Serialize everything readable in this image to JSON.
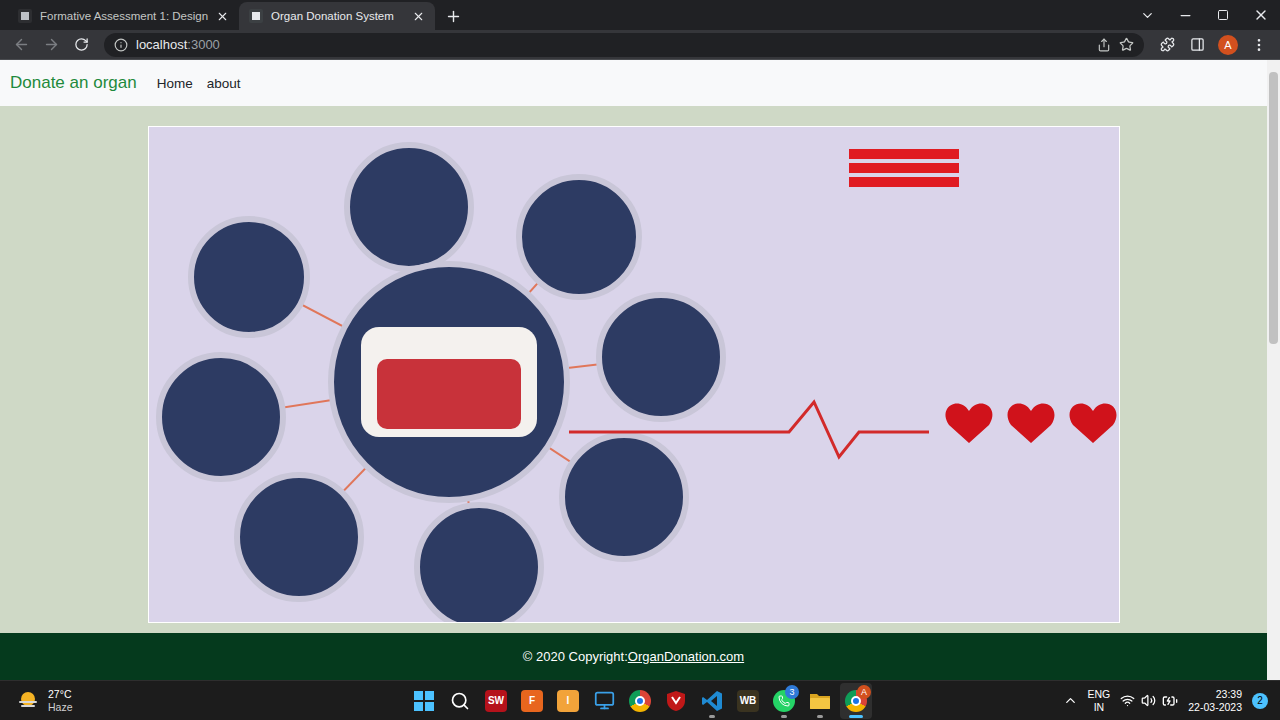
{
  "window": {
    "tabs": [
      {
        "title": "Formative Assessment 1: Design",
        "selected": false
      },
      {
        "title": "Organ Donation System",
        "selected": true
      }
    ],
    "nav": {
      "back": {
        "disabled": true
      },
      "forward": {
        "disabled": true
      }
    },
    "address": {
      "host": "localhost",
      "port": ":3000"
    },
    "profile": "A"
  },
  "page": {
    "brand": "Donate an organ",
    "nav": [
      {
        "label": "Home"
      },
      {
        "label": "about"
      }
    ],
    "footer": {
      "prefix": "© 2020 Copyright:",
      "link": "OrganDonation.com"
    }
  },
  "taskbar": {
    "weather": {
      "temp": "27°C",
      "condition": "Haze"
    },
    "apps": [
      {
        "kind": "windows",
        "text": "",
        "color": "#4cc2ff",
        "badge": "",
        "running": false,
        "selected": false
      },
      {
        "kind": "search",
        "text": "",
        "color": "#ffffff",
        "badge": "",
        "running": false,
        "selected": false
      },
      {
        "kind": "tile",
        "text": "SW",
        "color": "#b5121b",
        "badge": "",
        "running": false,
        "selected": false
      },
      {
        "kind": "tile",
        "text": "F",
        "color": "#e8661e",
        "badge": "",
        "running": false,
        "selected": false
      },
      {
        "kind": "tile",
        "text": "I",
        "color": "#f2a33a",
        "badge": "",
        "running": false,
        "selected": false
      },
      {
        "kind": "monitor",
        "text": "",
        "color": "#3aa0e8",
        "badge": "",
        "running": false,
        "selected": false
      },
      {
        "kind": "chrome",
        "text": "",
        "color": "#1a73e8",
        "badge": "",
        "running": false,
        "selected": false
      },
      {
        "kind": "shield",
        "text": "",
        "color": "#c01818",
        "badge": "",
        "running": false,
        "selected": false
      },
      {
        "kind": "vscode",
        "text": "",
        "color": "#1f8ad2",
        "badge": "",
        "running": true,
        "selected": false
      },
      {
        "kind": "tile",
        "text": "WB",
        "color": "#3a3320",
        "badge": "",
        "running": false,
        "selected": false
      },
      {
        "kind": "whatsapp",
        "text": "",
        "color": "#25d366",
        "badge": "3",
        "running": true,
        "selected": false
      },
      {
        "kind": "folder",
        "text": "",
        "color": "#f4c542",
        "badge": "",
        "running": true,
        "selected": false
      },
      {
        "kind": "chrome",
        "text": "",
        "color": "#1a73e8",
        "badge": "A",
        "running": true,
        "selected": true
      }
    ],
    "tray": {
      "lang": "ENG",
      "region": "IN",
      "time": "23:39",
      "date": "22-03-2023",
      "notifications": "2"
    }
  }
}
